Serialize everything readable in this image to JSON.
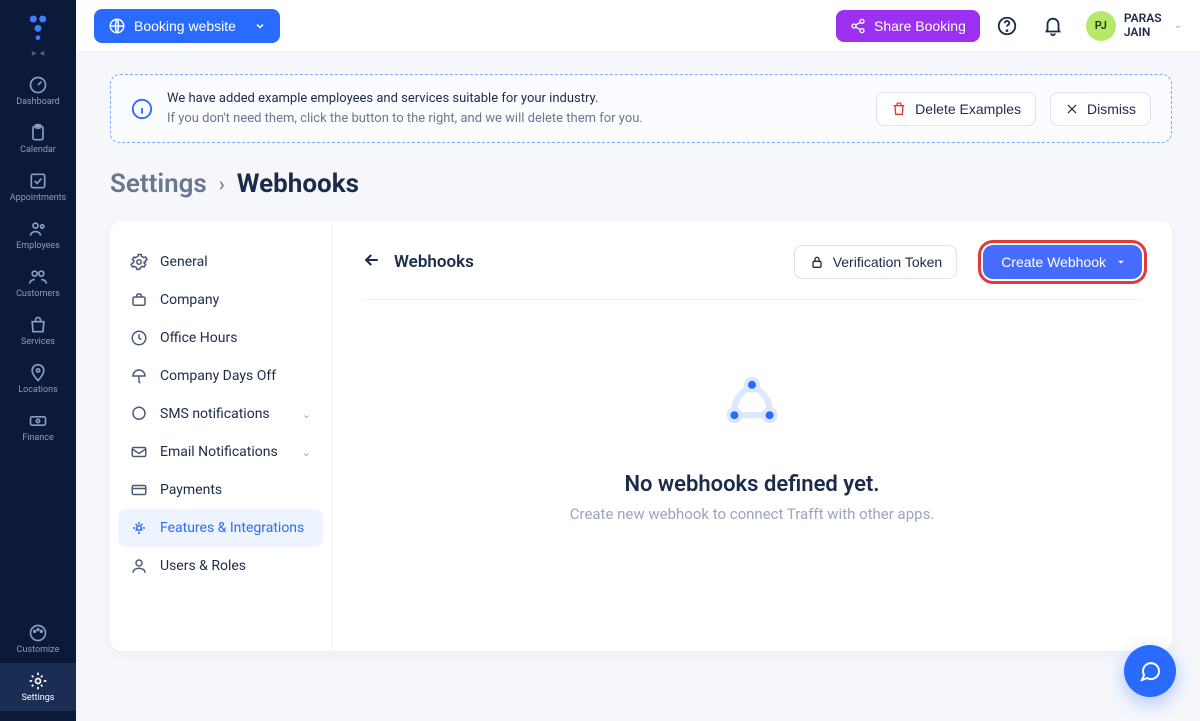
{
  "sidebar": {
    "items": [
      {
        "label": "Dashboard",
        "icon": "gauge"
      },
      {
        "label": "Calendar",
        "icon": "clipboard"
      },
      {
        "label": "Appointments",
        "icon": "check-square"
      },
      {
        "label": "Employees",
        "icon": "users"
      },
      {
        "label": "Customers",
        "icon": "customers"
      },
      {
        "label": "Services",
        "icon": "bag"
      },
      {
        "label": "Locations",
        "icon": "pin"
      },
      {
        "label": "Finance",
        "icon": "cash"
      }
    ],
    "bottom": [
      {
        "label": "Customize",
        "icon": "palette"
      },
      {
        "label": "Settings",
        "icon": "gear"
      }
    ]
  },
  "topbar": {
    "website_label": "Booking website",
    "share_label": "Share Booking",
    "user_initials": "PJ",
    "user_name_line1": "PARAS",
    "user_name_line2": "JAIN"
  },
  "banner": {
    "line1": "We have added example employees and services suitable for your industry.",
    "line2": "If you don't need them, click the button to the right, and we will delete them for you.",
    "delete_label": "Delete Examples",
    "dismiss_label": "Dismiss"
  },
  "breadcrumb": {
    "root": "Settings",
    "current": "Webhooks"
  },
  "settings_menu": {
    "items": [
      {
        "label": "General",
        "icon": "gear-thin"
      },
      {
        "label": "Company",
        "icon": "briefcase"
      },
      {
        "label": "Office Hours",
        "icon": "clock"
      },
      {
        "label": "Company Days Off",
        "icon": "umbrella"
      },
      {
        "label": "SMS notifications",
        "icon": "chat",
        "expandable": true
      },
      {
        "label": "Email Notifications",
        "icon": "mail",
        "expandable": true
      },
      {
        "label": "Payments",
        "icon": "card"
      },
      {
        "label": "Features & Integrations",
        "icon": "spark",
        "active": true
      },
      {
        "label": "Users & Roles",
        "icon": "person"
      }
    ]
  },
  "panel": {
    "title": "Webhooks",
    "verification_label": "Verification Token",
    "create_label": "Create Webhook",
    "empty_title": "No webhooks defined yet.",
    "empty_sub": "Create new webhook to connect Trafft with other apps."
  }
}
